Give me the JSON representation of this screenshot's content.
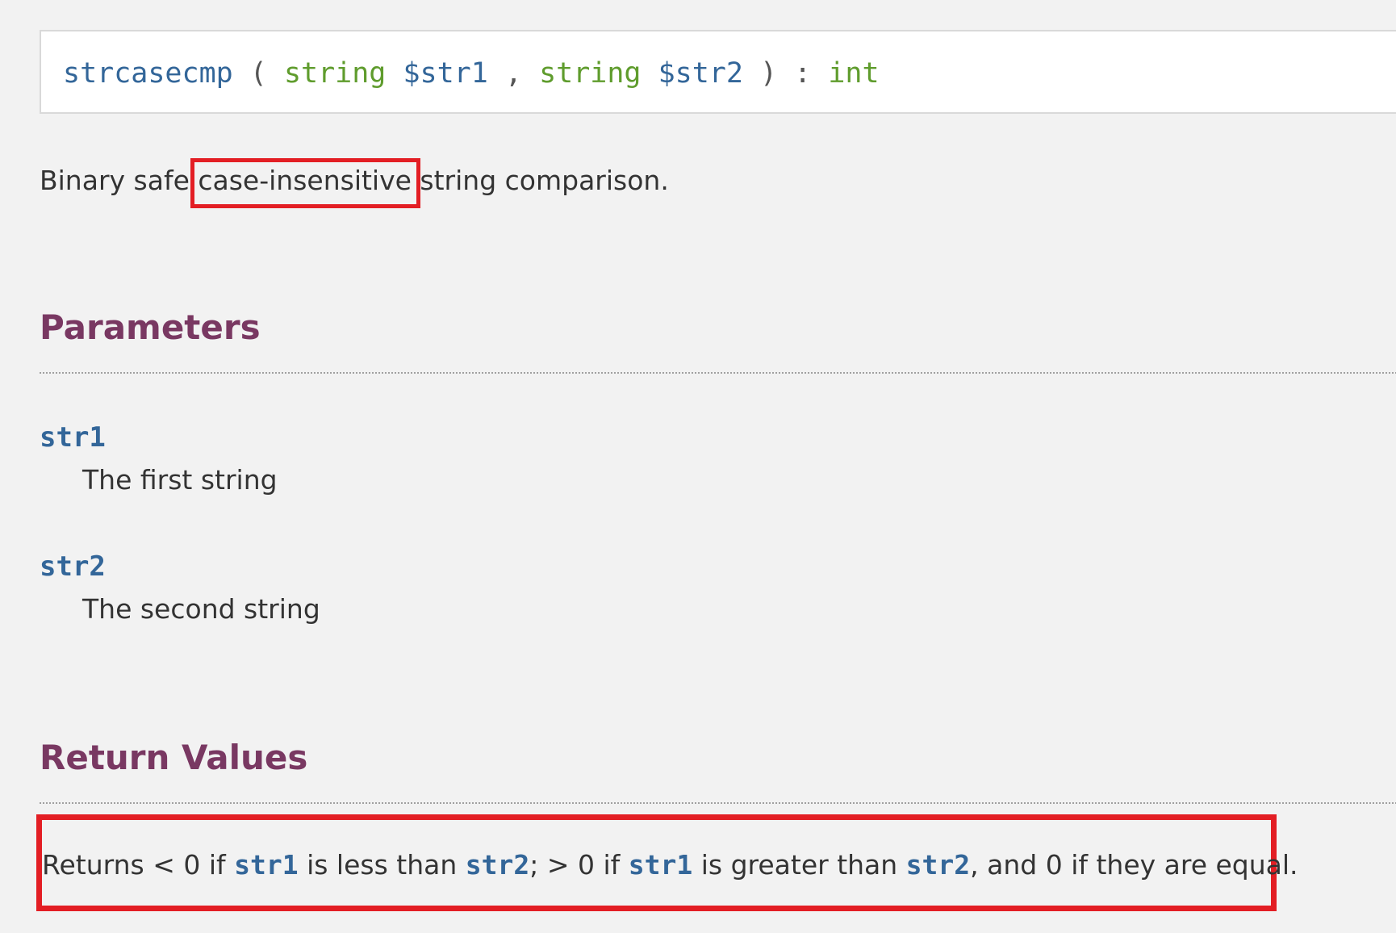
{
  "synopsis": {
    "function_name": "strcasecmp",
    "open_paren": "(",
    "param1_type": "string",
    "param1_var": "$str1",
    "comma": ",",
    "param2_type": "string",
    "param2_var": "$str2",
    "close_paren": ")",
    "colon": ":",
    "return_type": "int"
  },
  "description": {
    "before": "Binary safe ",
    "highlight": "case-insensitive",
    "after": " string comparison."
  },
  "parameters": {
    "title": "Parameters",
    "items": [
      {
        "name": "str1",
        "description": "The first string"
      },
      {
        "name": "str2",
        "description": "The second string"
      }
    ]
  },
  "return_values": {
    "title": "Return Values",
    "parts": [
      "Returns < 0 if ",
      "str1",
      " is less than ",
      "str2",
      "; > 0 if ",
      "str1",
      " is greater than ",
      "str2",
      ", and 0 if they are equal."
    ]
  },
  "colors": {
    "heading": "#793862",
    "code_var": "#336699",
    "code_type": "#5f9c2d",
    "highlight_box": "#e31e24",
    "background": "#f2f2f2"
  }
}
